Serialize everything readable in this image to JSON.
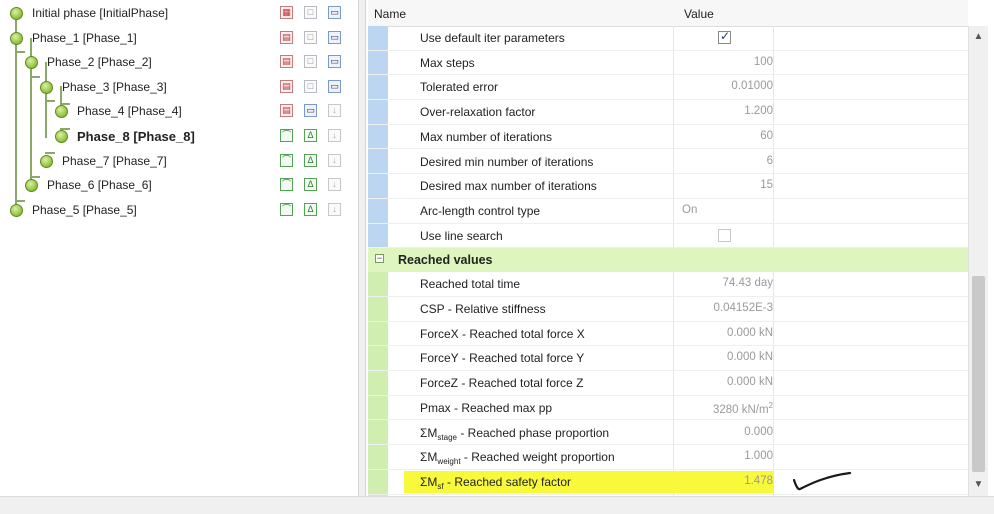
{
  "tree": {
    "phases": [
      {
        "label": "Initial phase [InitialPhase]",
        "bold": false,
        "depth": 0,
        "icons": [
          "calc-grid-icon",
          "grid-icon",
          "save-icon"
        ]
      },
      {
        "label": "Phase_1 [Phase_1]",
        "bold": false,
        "depth": 0,
        "icons": [
          "calc-icon",
          "grid-icon",
          "save-icon"
        ]
      },
      {
        "label": "Phase_2 [Phase_2]",
        "bold": false,
        "depth": 1,
        "icons": [
          "calc-icon",
          "grid-icon",
          "save-icon"
        ]
      },
      {
        "label": "Phase_3 [Phase_3]",
        "bold": false,
        "depth": 2,
        "icons": [
          "calc-icon",
          "grid-icon",
          "save-icon"
        ]
      },
      {
        "label": "Phase_4 [Phase_4]",
        "bold": false,
        "depth": 3,
        "icons": [
          "calc-icon",
          "save-icon",
          "down-arrow-icon"
        ]
      },
      {
        "label": "Phase_8 [Phase_8]",
        "bold": true,
        "depth": 3,
        "icons": [
          "curve-icon",
          "triangle-icon",
          "down-arrow-icon"
        ]
      },
      {
        "label": "Phase_7 [Phase_7]",
        "bold": false,
        "depth": 2,
        "icons": [
          "curve-icon",
          "triangle-icon",
          "down-arrow-icon"
        ]
      },
      {
        "label": "Phase_6 [Phase_6]",
        "bold": false,
        "depth": 1,
        "icons": [
          "curve-icon",
          "triangle-icon",
          "down-arrow-icon"
        ]
      },
      {
        "label": "Phase_5 [Phase_5]",
        "bold": false,
        "depth": 0,
        "icons": [
          "curve-icon",
          "triangle-icon",
          "down-arrow-icon"
        ]
      }
    ]
  },
  "properties": {
    "header": {
      "name": "Name",
      "value": "Value"
    },
    "rows_top": [
      {
        "name": "Use default iter parameters",
        "type": "checkbox",
        "checked": true
      },
      {
        "name": "Max steps",
        "value": "100"
      },
      {
        "name": "Tolerated error",
        "value": "0.01000"
      },
      {
        "name": "Over-relaxation factor",
        "value": "1.200"
      },
      {
        "name": "Max number of iterations",
        "value": "60"
      },
      {
        "name": "Desired min number of iterations",
        "value": "6"
      },
      {
        "name": "Desired max number of iterations",
        "value": "15"
      },
      {
        "name": "Arc-length control type",
        "value": "On",
        "align": "left"
      },
      {
        "name": "Use line search",
        "type": "checkbox",
        "checked": false
      }
    ],
    "category": {
      "label": "Reached values",
      "toggle": "−"
    },
    "rows_reached": [
      {
        "name": "Reached total time",
        "value": "74.43 day"
      },
      {
        "name": "CSP - Relative stiffness",
        "value": "0.04152E-3"
      },
      {
        "name": "ForceX - Reached total force X",
        "value": "0.000 kN"
      },
      {
        "name": "ForceY - Reached total force Y",
        "value": "0.000 kN"
      },
      {
        "name": "ForceZ - Reached total force Z",
        "value": "0.000 kN"
      },
      {
        "name": "Pmax - Reached max pp",
        "value": "3280 kN/m",
        "value_sup": "2"
      },
      {
        "name_main": "ΣM",
        "name_sub": "stage",
        "name_rest": " - Reached phase proportion",
        "value": "0.000"
      },
      {
        "name_main": "ΣM",
        "name_sub": "weight",
        "name_rest": " - Reached weight proportion",
        "value": "1.000"
      },
      {
        "name_main": "ΣM",
        "name_sub": "sf",
        "name_rest": " - Reached safety factor",
        "value": "1.478",
        "highlight": true
      }
    ]
  },
  "colors": {
    "category_bg": "#dff5bf",
    "highlight": "#f7f93a",
    "top_strip": "#bcd6f2",
    "bottom_strip": "#cfeeb0"
  }
}
